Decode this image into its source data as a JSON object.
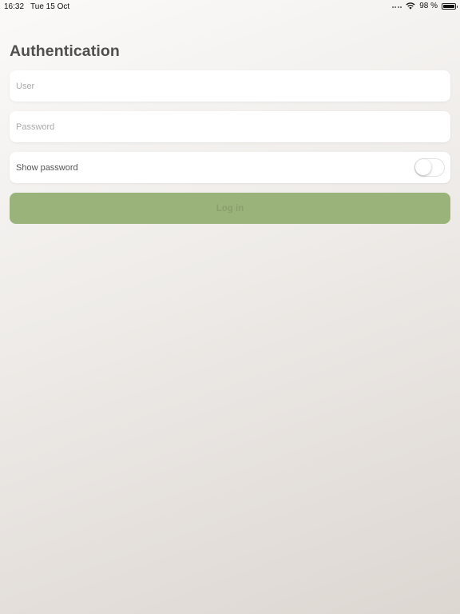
{
  "status_bar": {
    "time": "16:32",
    "date": "Tue 15 Oct",
    "battery_text": "98 %",
    "battery_level": 0.98
  },
  "page": {
    "title": "Authentication"
  },
  "form": {
    "user_placeholder": "User",
    "user_value": "",
    "password_placeholder": "Password",
    "password_value": "",
    "show_password_label": "Show password",
    "show_password_on": false,
    "login_label": "Log in"
  },
  "colors": {
    "login_button_bg": "#9ab37a",
    "login_button_text": "#89a06c"
  },
  "icons": {
    "signal": "signal-dots-icon",
    "wifi": "wifi-icon",
    "battery": "battery-icon"
  }
}
